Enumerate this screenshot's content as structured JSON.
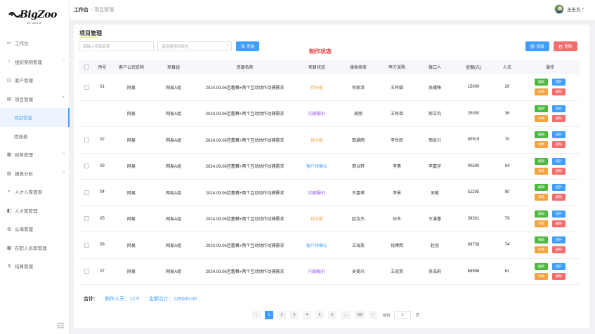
{
  "logo": {
    "text": "BigZoo",
    "subtitle": "STUDIO"
  },
  "sidebar": {
    "items": [
      {
        "label": "工作台",
        "icon": "desktop-icon",
        "arrow": ""
      },
      {
        "label": "组织架构管理",
        "icon": "org-icon",
        "arrow": "›"
      },
      {
        "label": "客户管理",
        "icon": "customer-icon",
        "arrow": ""
      },
      {
        "label": "项目管理",
        "icon": "project-icon",
        "arrow": "˄"
      },
      {
        "label": "项目信息",
        "icon": "",
        "arrow": ""
      },
      {
        "label": "绩效表",
        "icon": "",
        "arrow": ""
      },
      {
        "label": "财务管理",
        "icon": "finance-icon",
        "arrow": "›"
      },
      {
        "label": "报表分析",
        "icon": "chart-icon",
        "arrow": "›"
      },
      {
        "label": "人才入库查询",
        "icon": "search-icon",
        "arrow": ""
      },
      {
        "label": "人才库管理",
        "icon": "talent-icon",
        "arrow": ""
      },
      {
        "label": "公海管理",
        "icon": "pool-icon",
        "arrow": ""
      },
      {
        "label": "在职人员库管理",
        "icon": "staff-icon",
        "arrow": ""
      },
      {
        "label": "结算管理",
        "icon": "dollar-icon",
        "arrow": ""
      }
    ]
  },
  "topbar": {
    "crumb_home": "工作台",
    "crumb_sep": "/",
    "crumb_current": "项目管理",
    "user_name": "王东方"
  },
  "page": {
    "title": "项目管理",
    "search_name_placeholder": "请输入项目名称",
    "search_status_placeholder": "请选择项目状态",
    "query_label": "查询",
    "add_label": "添加",
    "delete_label": "删除",
    "annotation": "制作状态"
  },
  "table": {
    "headers": [
      "序号",
      "客户公司名称",
      "项目组",
      "资源名称",
      "项目状态",
      "接收商务",
      "甲方采购",
      "接口人",
      "金额(元)",
      "人天",
      "操作"
    ],
    "ops": {
      "edit": "编辑",
      "upgrade": "提升",
      "detail": "详情",
      "delete": "删除"
    },
    "rows": [
      {
        "no": "01",
        "company": "网易",
        "group": "网易A组",
        "name": "2024.09.06芭蕾舞+两个互动动作动捕需求",
        "status": "待分配",
        "status_color": "#e6a23c",
        "receiver": "何家洪",
        "buyer": "王柃娟",
        "contact": "吴耀锋",
        "amount": "15000",
        "days": "20",
        "checkbox": true
      },
      {
        "no": "",
        "company": "网易",
        "group": "网易A组",
        "name": "2024.09.06芭蕾舞+两个互动动作动捕需求",
        "status": "内部报价",
        "status_color": "#8e44ef",
        "receiver": "周丽",
        "buyer": "王民瑶",
        "contact": "邢文钧",
        "amount": "25000",
        "days": "36",
        "checkbox": false
      },
      {
        "no": "02",
        "company": "网易",
        "group": "网易A组",
        "name": "2024.09.06芭蕾舞+两个互动动作动捕需求",
        "status": "待分配",
        "status_color": "#e6a23c",
        "receiver": "邢灏雨",
        "buyer": "李世民",
        "contact": "邢永兴",
        "amount": "80919",
        "days": "70",
        "checkbox": true
      },
      {
        "no": "03",
        "company": "网易",
        "group": "网易A组",
        "name": "2024.09.06芭蕾舞+两个互动动作动捕需求",
        "status": "客户待确认",
        "status_color": "#409eff",
        "receiver": "邢以轩",
        "buyer": "李素",
        "contact": "李嘉宇",
        "amount": "90590",
        "days": "94",
        "checkbox": true
      },
      {
        "no": "04",
        "company": "网易",
        "group": "网易A组",
        "name": "2024.09.06芭蕾舞+两个互动动作动捕需求",
        "status": "内部报价",
        "status_color": "#8e44ef",
        "receiver": "王嘉琪",
        "buyer": "李景",
        "contact": "吴敏",
        "amount": "51195",
        "days": "90",
        "checkbox": true
      },
      {
        "no": "05",
        "company": "网易",
        "group": "网易A组",
        "name": "2024.09.06芭蕾舞+两个互动动作动捕需求",
        "status": "待分配",
        "status_color": "#e6a23c",
        "receiver": "赵汝杰",
        "buyer": "孙木",
        "contact": "王溪蕾",
        "amount": "39301",
        "days": "79",
        "checkbox": true
      },
      {
        "no": "06",
        "company": "网易",
        "group": "网易A组",
        "name": "2024.09.06芭蕾舞+两个互动动作动捕需求",
        "status": "客户待确认",
        "status_color": "#409eff",
        "receiver": "王海英",
        "buyer": "钱博西",
        "contact": "赵容",
        "amount": "88738",
        "days": "74",
        "checkbox": true
      },
      {
        "no": "07",
        "company": "网易",
        "group": "网易A组",
        "name": "2024.09.06芭蕾舞+两个互动动作动捕需求",
        "status": "内部报价",
        "status_color": "#8e44ef",
        "receiver": "吴美兴",
        "buyer": "王冠英",
        "contact": "吴浩莉",
        "amount": "68996",
        "days": "61",
        "checkbox": true
      }
    ]
  },
  "summary": {
    "total_label": "合计:",
    "days_text": "制作人天：12.5",
    "amount_text": "金额合计：125000.00"
  },
  "pager": {
    "prev": "‹",
    "pages": [
      "1",
      "2",
      "3",
      "4",
      "5",
      "6",
      "...",
      "100"
    ],
    "next": "›",
    "goto_label": "前往",
    "goto_value": "2",
    "goto_suffix": "页"
  }
}
